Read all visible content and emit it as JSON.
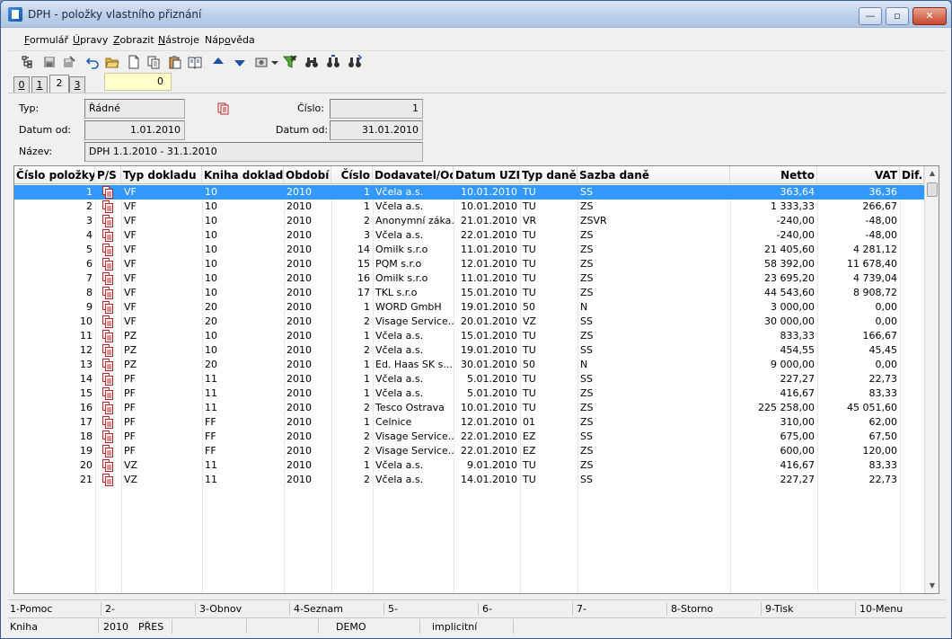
{
  "window": {
    "title": "DPH - položky vlastního přiznání",
    "btn_minimize": "—",
    "btn_maximize": "▫",
    "btn_close": "✕"
  },
  "menu": {
    "formular": {
      "u": "F",
      "rest": "ormulář"
    },
    "upravy": {
      "u": "Ú",
      "rest": "pravy"
    },
    "zobrazit": {
      "u": "Z",
      "rest": "obrazit"
    },
    "nastroje": {
      "u": "N",
      "rest": "ástroje"
    },
    "napoveda": {
      "pre": "Náp",
      "u": "o",
      "rest": "věda"
    }
  },
  "toolbar": {
    "icons": [
      "tree-icon",
      "save-icon",
      "save-as-icon",
      "undo-icon",
      "open-folder-icon",
      "new-doc-icon",
      "copy-icon",
      "paste-icon",
      "book-icon",
      "arrow-up-icon",
      "arrow-down-icon",
      "settings-icon",
      "dropdown-arrow-icon",
      "filter-icon",
      "binoculars-icon",
      "binoculars-next-icon",
      "binoculars-prev-icon"
    ]
  },
  "tabs": {
    "t0": "0",
    "t1": "1",
    "t2": "2",
    "t3": "3",
    "counter": "0"
  },
  "form": {
    "typ_label": "Typ:",
    "typ_value": "Řádné",
    "cislo_label": "Číslo:",
    "cislo_value": "1",
    "datum_od_label": "Datum od:",
    "datum_od_value": "1.01.2010",
    "datum_do_label": "Datum od:",
    "datum_do_value": "31.01.2010",
    "nazev_label": "Název:",
    "nazev_value": "DPH 1.1.2010 - 31.1.2010"
  },
  "grid": {
    "headers": {
      "cislo_polozky": "Číslo položky",
      "ps": "P/S",
      "typ_dokladu": "Typ dokladu",
      "kniha_dokladu": "Kniha dokladu",
      "obdobi": "Období",
      "cislo": "Číslo",
      "dodavatel": "Dodavatel/Odběratel",
      "datum_uzp": "Datum UZP",
      "typ_dane": "Typ daně",
      "sazba_dane": "Sazba daně",
      "netto": "Netto",
      "vat": "VAT",
      "dif": "Dif."
    },
    "rows": [
      {
        "n": "1",
        "typ": "VF",
        "kniha": "10",
        "obd": "2010",
        "c": "1",
        "dod": "Včela a.s.",
        "dat": "10.01.2010",
        "td": "TU",
        "sz": "SS",
        "net": "363,64",
        "vat": "36,36"
      },
      {
        "n": "2",
        "typ": "VF",
        "kniha": "10",
        "obd": "2010",
        "c": "1",
        "dod": "Včela a.s.",
        "dat": "10.01.2010",
        "td": "TU",
        "sz": "ZS",
        "net": "1 333,33",
        "vat": "266,67"
      },
      {
        "n": "3",
        "typ": "VF",
        "kniha": "10",
        "obd": "2010",
        "c": "2",
        "dod": "Anonymní záka...",
        "dat": "21.01.2010",
        "td": "VR",
        "sz": "ZSVR",
        "net": "-240,00",
        "vat": "-48,00"
      },
      {
        "n": "4",
        "typ": "VF",
        "kniha": "10",
        "obd": "2010",
        "c": "3",
        "dod": "Včela a.s.",
        "dat": "22.01.2010",
        "td": "TU",
        "sz": "ZS",
        "net": "-240,00",
        "vat": "-48,00"
      },
      {
        "n": "5",
        "typ": "VF",
        "kniha": "10",
        "obd": "2010",
        "c": "14",
        "dod": "Omilk s.r.o",
        "dat": "11.01.2010",
        "td": "TU",
        "sz": "ZS",
        "net": "21 405,60",
        "vat": "4 281,12"
      },
      {
        "n": "6",
        "typ": "VF",
        "kniha": "10",
        "obd": "2010",
        "c": "15",
        "dod": "PQM s.r.o",
        "dat": "12.01.2010",
        "td": "TU",
        "sz": "ZS",
        "net": "58 392,00",
        "vat": "11 678,40"
      },
      {
        "n": "7",
        "typ": "VF",
        "kniha": "10",
        "obd": "2010",
        "c": "16",
        "dod": "Omilk s.r.o",
        "dat": "11.01.2010",
        "td": "TU",
        "sz": "ZS",
        "net": "23 695,20",
        "vat": "4 739,04"
      },
      {
        "n": "8",
        "typ": "VF",
        "kniha": "10",
        "obd": "2010",
        "c": "17",
        "dod": "TKL s.r.o",
        "dat": "15.01.2010",
        "td": "TU",
        "sz": "ZS",
        "net": "44 543,60",
        "vat": "8 908,72"
      },
      {
        "n": "9",
        "typ": "VF",
        "kniha": "20",
        "obd": "2010",
        "c": "1",
        "dod": "WORD GmbH",
        "dat": "19.01.2010",
        "td": "50",
        "sz": "N",
        "net": "3 000,00",
        "vat": "0,00"
      },
      {
        "n": "10",
        "typ": "VF",
        "kniha": "20",
        "obd": "2010",
        "c": "2",
        "dod": "Visage Service...",
        "dat": "20.01.2010",
        "td": "VZ",
        "sz": "SS",
        "net": "30 000,00",
        "vat": "0,00"
      },
      {
        "n": "11",
        "typ": "PZ",
        "kniha": "10",
        "obd": "2010",
        "c": "1",
        "dod": "Včela a.s.",
        "dat": "15.01.2010",
        "td": "TU",
        "sz": "ZS",
        "net": "833,33",
        "vat": "166,67"
      },
      {
        "n": "12",
        "typ": "PZ",
        "kniha": "10",
        "obd": "2010",
        "c": "2",
        "dod": "Včela a.s.",
        "dat": "19.01.2010",
        "td": "TU",
        "sz": "SS",
        "net": "454,55",
        "vat": "45,45"
      },
      {
        "n": "13",
        "typ": "PZ",
        "kniha": "20",
        "obd": "2010",
        "c": "1",
        "dod": "Ed. Haas SK s....",
        "dat": "30.01.2010",
        "td": "50",
        "sz": "N",
        "net": "9 000,00",
        "vat": "0,00"
      },
      {
        "n": "14",
        "typ": "PF",
        "kniha": "11",
        "obd": "2010",
        "c": "1",
        "dod": "Včela a.s.",
        "dat": "5.01.2010",
        "td": "TU",
        "sz": "SS",
        "net": "227,27",
        "vat": "22,73"
      },
      {
        "n": "15",
        "typ": "PF",
        "kniha": "11",
        "obd": "2010",
        "c": "1",
        "dod": "Včela a.s.",
        "dat": "5.01.2010",
        "td": "TU",
        "sz": "ZS",
        "net": "416,67",
        "vat": "83,33"
      },
      {
        "n": "16",
        "typ": "PF",
        "kniha": "11",
        "obd": "2010",
        "c": "2",
        "dod": "Tesco Ostrava",
        "dat": "10.01.2010",
        "td": "TU",
        "sz": "ZS",
        "net": "225 258,00",
        "vat": "45 051,60"
      },
      {
        "n": "17",
        "typ": "PF",
        "kniha": "FF",
        "obd": "2010",
        "c": "1",
        "dod": "Celnice",
        "dat": "12.01.2010",
        "td": "01",
        "sz": "ZS",
        "net": "310,00",
        "vat": "62,00"
      },
      {
        "n": "18",
        "typ": "PF",
        "kniha": "FF",
        "obd": "2010",
        "c": "2",
        "dod": "Visage Service...",
        "dat": "22.01.2010",
        "td": "EZ",
        "sz": "SS",
        "net": "675,00",
        "vat": "67,50"
      },
      {
        "n": "19",
        "typ": "PF",
        "kniha": "FF",
        "obd": "2010",
        "c": "2",
        "dod": "Visage Service...",
        "dat": "22.01.2010",
        "td": "EZ",
        "sz": "ZS",
        "net": "600,00",
        "vat": "120,00"
      },
      {
        "n": "20",
        "typ": "VZ",
        "kniha": "11",
        "obd": "2010",
        "c": "1",
        "dod": "Včela a.s.",
        "dat": "9.01.2010",
        "td": "TU",
        "sz": "ZS",
        "net": "416,67",
        "vat": "83,33"
      },
      {
        "n": "21",
        "typ": "VZ",
        "kniha": "11",
        "obd": "2010",
        "c": "2",
        "dod": "Včela a.s.",
        "dat": "14.01.2010",
        "td": "TU",
        "sz": "SS",
        "net": "227,27",
        "vat": "22,73"
      }
    ]
  },
  "fkeys": [
    "1-Pomoc",
    "2-",
    "3-Obnov",
    "4-Seznam",
    "5-",
    "6-",
    "7-",
    "8-Storno",
    "9-Tisk",
    "10-Menu"
  ],
  "status": {
    "s1": "Kniha",
    "s2": "2010",
    "s3": "PŘES",
    "s4": "DEMO",
    "s5": "implicitní"
  },
  "colors": {
    "selection": "#3399ff",
    "counter_bg": "#ffffcc"
  }
}
